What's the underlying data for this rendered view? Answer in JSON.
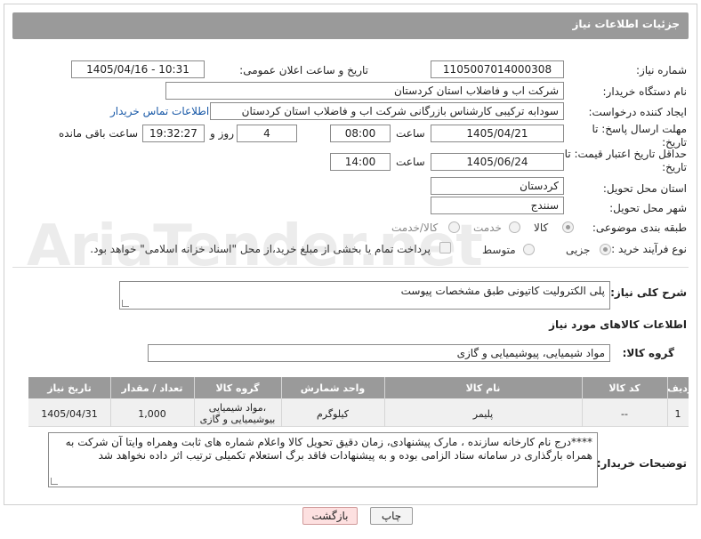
{
  "header": {
    "title": "جزئیات اطلاعات نیاز"
  },
  "fields": {
    "need_number_label": "شماره نیاز:",
    "need_number": "1105007014000308",
    "announce_datetime_label": "تاریخ و ساعت اعلان عمومی:",
    "announce_datetime": "1405/04/16 - 10:31",
    "buyer_org_label": "نام دستگاه خریدار:",
    "buyer_org": "شرکت اب و فاضلاب استان کردستان",
    "requester_label": "ایجاد کننده درخواست:",
    "requester": "سودابه ترکیبی کارشناس بازرگانی شرکت اب و فاضلاب استان کردستان",
    "buyer_contact_link": "اطلاعات تماس خریدار",
    "reply_deadline_label": "مهلت ارسال پاسخ: تا تاریخ:",
    "reply_date": "1405/04/21",
    "time_label": "ساعت",
    "reply_time": "08:00",
    "days_value": "4",
    "days_label": "روز و",
    "remaining_time": "19:32:27",
    "remaining_label": "ساعت باقی مانده",
    "price_validity_label": "حداقل تاریخ اعتبار قیمت: تا تاریخ:",
    "price_date": "1405/06/24",
    "price_time": "14:00",
    "province_label": "استان محل تحویل:",
    "province": "کردستان",
    "city_label": "شهر محل تحویل:",
    "city": "سنندج",
    "category_label": "طبقه بندی موضوعی:",
    "category_goods": "کالا",
    "category_service": "خدمت",
    "category_goods_service": "کالا/خدمت",
    "process_label": "نوع فرآیند خرید :",
    "process_partial": "جزیی",
    "process_medium": "متوسط",
    "payment_note": "پرداخت تمام یا بخشی از مبلغ خرید،از محل \"اسناد خزانه اسلامی\" خواهد بود."
  },
  "description": {
    "label": "شرح کلی نیاز:",
    "value": "پلی الکترولیت کاتیونی طبق مشخصات پیوست"
  },
  "goods_info": {
    "title": "اطلاعات کالاهای مورد نیاز",
    "group_label": "گروه کالا:",
    "group_value": "مواد شیمیایی، پیوشیمیایی و  گازی"
  },
  "table": {
    "headers": {
      "row": "ردیف",
      "code": "کد کالا",
      "name": "نام کالا",
      "unit": "واحد شمارش",
      "group": "گروه کالا",
      "qty": "تعداد / مقدار",
      "date": "تاریخ نیاز"
    },
    "rows": [
      {
        "row": "1",
        "code": "--",
        "name": "پلیمر",
        "unit": "کیلوگرم",
        "group_line1": "مواد شیمیایی،",
        "group_line2": "بیوشیمیایی و گازی",
        "qty": "1,000",
        "date": "1405/04/31"
      }
    ]
  },
  "buyer_notes": {
    "label": "توضیحات خریدار:",
    "value": "****درج نام کارخانه سازنده ، مارک پیشنهادی، زمان دقیق تحویل کالا واعلام شماره های ثابت وهمراه وایتا آن شرکت به همراه بارگذاری در سامانه ستاد الزامی بوده و به پیشنهادات فاقد برگ استعلام تکمیلی ترتیب اثر داده نخواهد شد"
  },
  "buttons": {
    "print": "چاپ",
    "back": "بازگشت"
  },
  "watermark": "AriaTender.net"
}
